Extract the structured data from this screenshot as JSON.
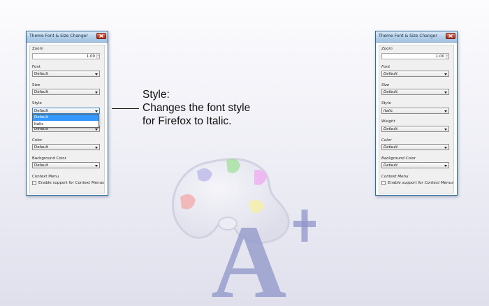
{
  "left_dialog": {
    "title": "Theme Font & Size Changer",
    "zoom_label": "Zoom",
    "zoom_value": "1.00",
    "font_label": "Font",
    "font_value": "Default",
    "size_label": "Size",
    "size_value": "Default",
    "style_label": "Style",
    "style_value": "Default",
    "style_options": [
      "Default",
      "Italic"
    ],
    "weight_value_partial": "Default",
    "color_label": "Color",
    "color_value": "Default",
    "bgcolor_label": "Background Color",
    "bgcolor_value": "Default",
    "context_label": "Context Menu",
    "context_checkbox_label": "Enable support for Context Menus"
  },
  "right_dialog": {
    "title": "Theme Font & Size Changer",
    "zoom_label": "Zoom",
    "zoom_value": "1.00",
    "font_label": "Font",
    "font_value": "Default",
    "size_label": "Size",
    "size_value": "Default",
    "style_label": "Style",
    "style_value": "Italic",
    "weight_label": "Weight",
    "weight_value": "Default",
    "color_label": "Color",
    "color_value": "Default",
    "bgcolor_label": "Background Color",
    "bgcolor_value": "Default",
    "context_label": "Context Menu",
    "context_checkbox_label": "Enable support for Context Menus"
  },
  "callout": {
    "line1": "Style:",
    "line2": "Changes the font style",
    "line3": "for Firefox to Italic."
  },
  "colors": {
    "accent": "#3399ff",
    "title_bar": "#b6d1ea",
    "close_button": "#c9422c",
    "logo_letter": "#8f96c9"
  }
}
